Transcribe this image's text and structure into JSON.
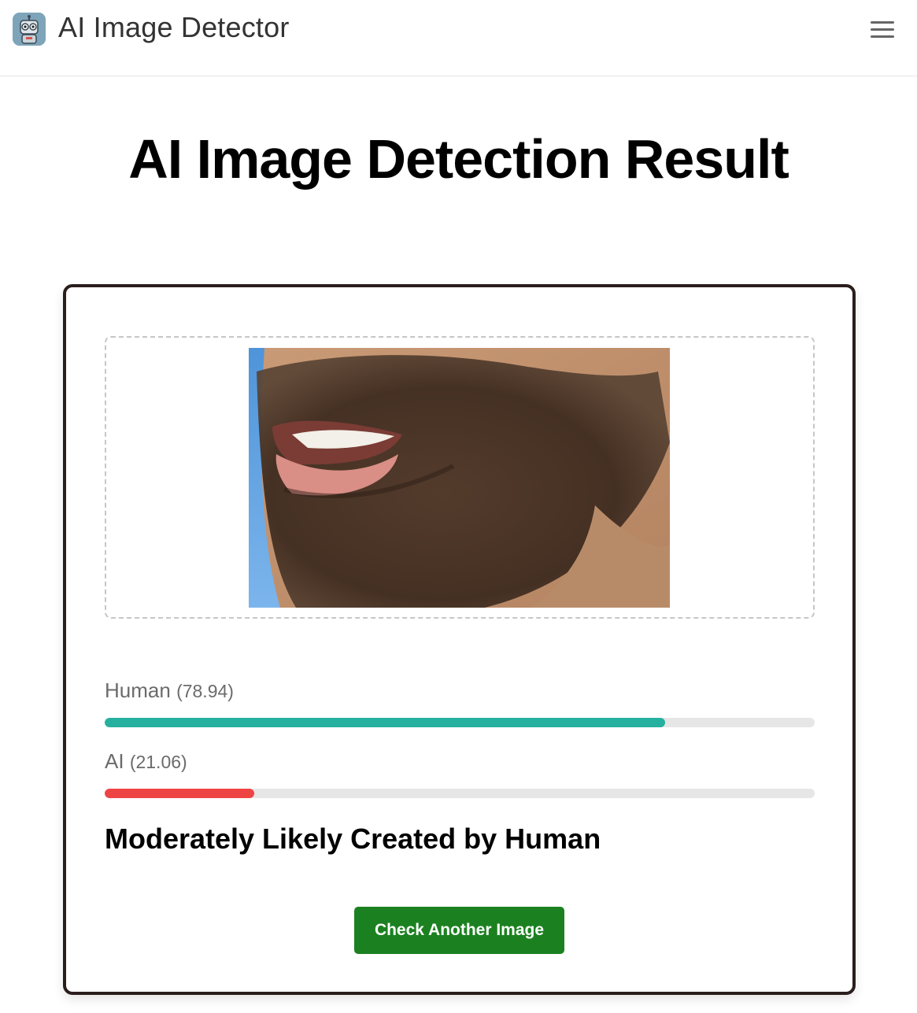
{
  "header": {
    "app_title": "AI Image Detector",
    "logo_icon": "robot-icon",
    "menu_icon": "hamburger-menu-icon"
  },
  "main": {
    "page_title": "AI Image Detection Result",
    "image_alt": "Uploaded image",
    "scores": [
      {
        "label": "Human",
        "value_text": "(78.94)",
        "value": 78.94,
        "color": "#26b0a0"
      },
      {
        "label": "AI",
        "value_text": "(21.06)",
        "value": 21.06,
        "color": "#ef4444"
      }
    ],
    "verdict": "Moderately Likely Created by Human",
    "check_button_label": "Check Another Image",
    "button_color": "#1b8120"
  }
}
